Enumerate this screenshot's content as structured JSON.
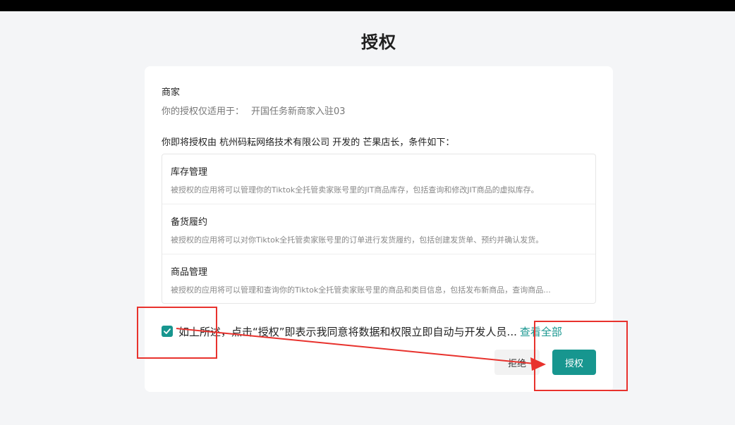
{
  "page": {
    "title": "授权"
  },
  "merchant": {
    "label": "商家",
    "scope_prefix": "你的授权仅适用于：",
    "scope_value": "开国任务新商家入驻03"
  },
  "intro": "你即将授权由 杭州码耘网络技术有限公司 开发的 芒果店长，条件如下：",
  "permissions": [
    {
      "name": "库存管理",
      "desc": "被授权的应用将可以管理你的Tiktok全托管卖家账号里的JIT商品库存，包括查询和修改JIT商品的虚拟库存。"
    },
    {
      "name": "备货履约",
      "desc": "被授权的应用将可以对你Tiktok全托管卖家账号里的订单进行发货履约，包括创建发货单、预约并确认发货。"
    },
    {
      "name": "商品管理",
      "desc": "被授权的应用将可以管理和查询你的Tiktok全托管卖家账号里的商品和类目信息，包括发布新商品，查询商品..."
    }
  ],
  "agreement": {
    "checked": true,
    "text": "如上所述，点击“授权”即表示我同意将数据和权限立即自动与开发人员...",
    "view_all": "查看全部"
  },
  "buttons": {
    "reject": "拒绝",
    "authorize": "授权"
  },
  "colors": {
    "accent": "#17968f",
    "annotation": "#e8322d"
  }
}
